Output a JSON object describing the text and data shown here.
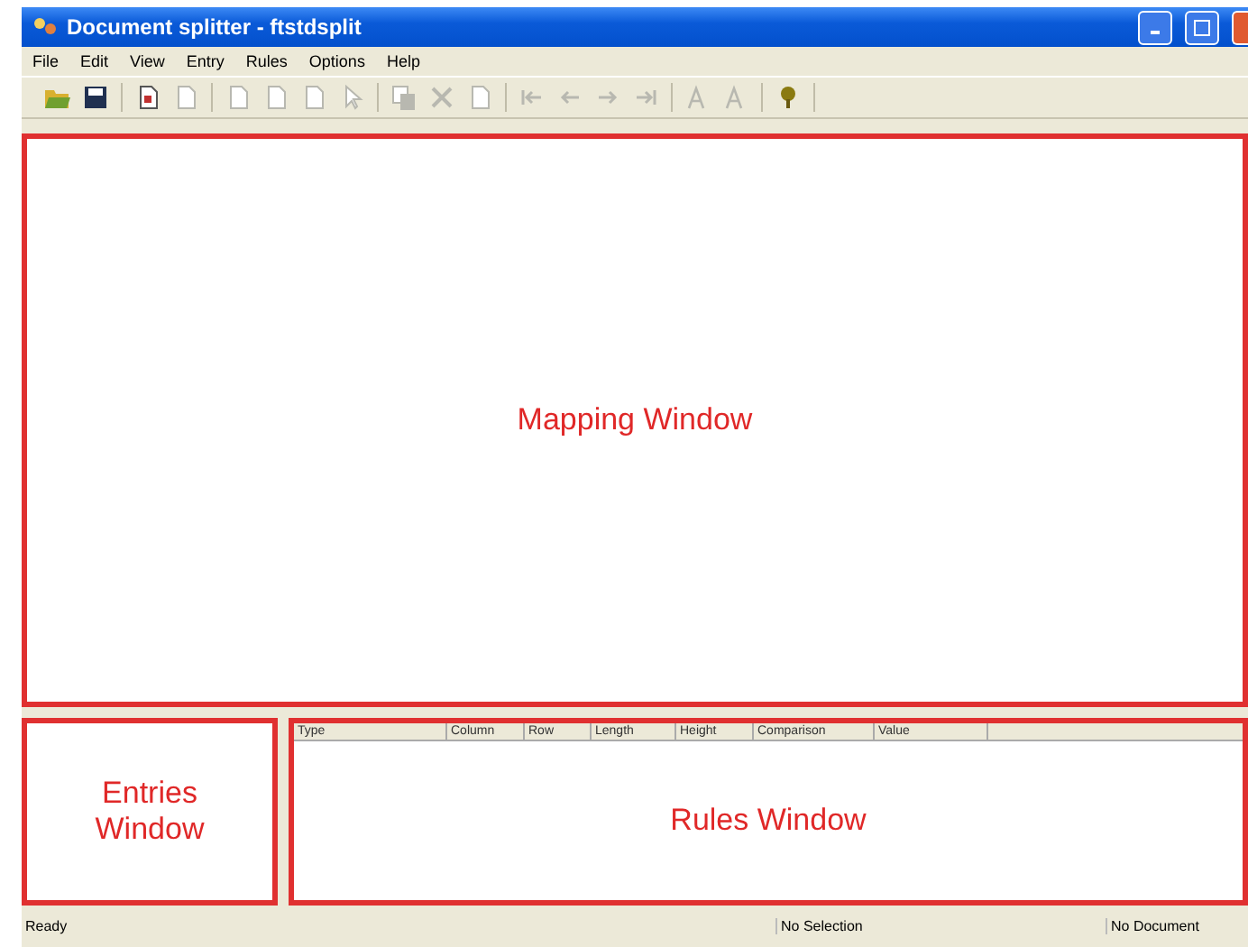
{
  "window": {
    "title": "Document splitter - ftstdsplit"
  },
  "menu": [
    "File",
    "Edit",
    "View",
    "Entry",
    "Rules",
    "Options",
    "Help"
  ],
  "toolbar": [
    [
      {
        "kind": "folder",
        "disabled": false
      },
      {
        "kind": "disk",
        "disabled": false
      }
    ],
    [
      {
        "kind": "page",
        "disabled": false
      },
      {
        "kind": "page",
        "disabled": true
      }
    ],
    [
      {
        "kind": "page",
        "disabled": true
      },
      {
        "kind": "page",
        "disabled": true
      },
      {
        "kind": "page",
        "disabled": true
      },
      {
        "kind": "cursor",
        "disabled": true
      }
    ],
    [
      {
        "kind": "copy",
        "disabled": true
      },
      {
        "kind": "cross",
        "disabled": true
      },
      {
        "kind": "page",
        "disabled": true
      }
    ],
    [
      {
        "kind": "first",
        "disabled": true
      },
      {
        "kind": "prev",
        "disabled": true
      },
      {
        "kind": "next",
        "disabled": true
      },
      {
        "kind": "last",
        "disabled": true
      }
    ],
    [
      {
        "kind": "font",
        "disabled": true
      },
      {
        "kind": "font",
        "disabled": true
      }
    ],
    [
      {
        "kind": "help",
        "disabled": false
      }
    ]
  ],
  "mapping": {
    "label": "Mapping Window"
  },
  "entries": {
    "label": "Entries\nWindow"
  },
  "rules": {
    "columns": [
      "Type",
      "Column",
      "Row",
      "Length",
      "Height",
      "Comparison",
      "Value"
    ],
    "label": "Rules Window"
  },
  "status_bar": [
    "Ready",
    "No Selection",
    "No Document"
  ]
}
